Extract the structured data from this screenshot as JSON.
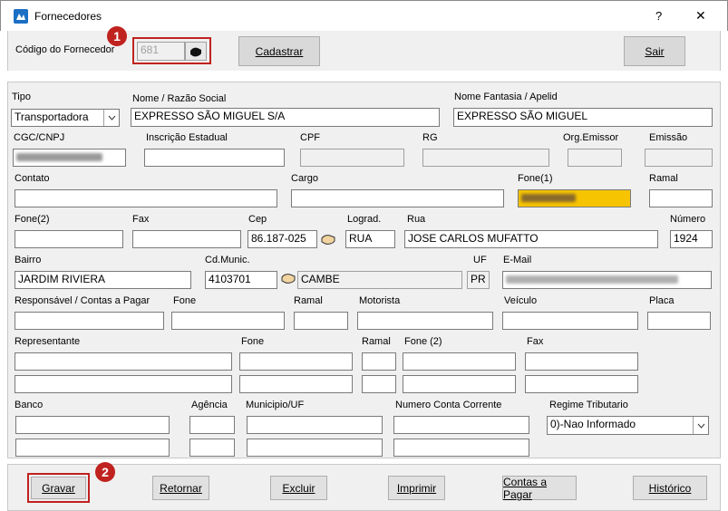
{
  "window": {
    "title": "Fornecedores",
    "help": "?",
    "close": "✕"
  },
  "top": {
    "codigo_label": "Código do Fornecedor",
    "codigo_value": "681",
    "cadastrar": "Cadastrar",
    "sair": "Sair",
    "badge1": "1"
  },
  "labels": {
    "tipo": "Tipo",
    "nome": "Nome / Razão Social",
    "fantasia": "Nome Fantasia / Apelid",
    "cgc": "CGC/CNPJ",
    "ie": "Inscrição Estadual",
    "cpf": "CPF",
    "rg": "RG",
    "orgemissor": "Org.Emissor",
    "emissao": "Emissão",
    "contato": "Contato",
    "cargo": "Cargo",
    "fone1": "Fone(1)",
    "ramal": "Ramal",
    "fone2": "Fone(2)",
    "fax": "Fax",
    "cep": "Cep",
    "lograd": "Lograd.",
    "rua": "Rua",
    "numero": "Número",
    "bairro": "Bairro",
    "cdmunic": "Cd.Munic.",
    "uf": "UF",
    "email": "E-Mail",
    "responsavel": "Responsável / Contas a Pagar",
    "fone_r": "Fone",
    "ramal_r": "Ramal",
    "motorista": "Motorista",
    "veiculo": "Veículo",
    "placa": "Placa",
    "representante": "Representante",
    "fone_rep": "Fone",
    "ramal_rep": "Ramal",
    "fone2_rep": "Fone (2)",
    "fax_rep": "Fax",
    "banco": "Banco",
    "agencia": "Agência",
    "municipio": "Municipio/UF",
    "conta": "Numero Conta Corrente",
    "regime": "Regime Tributario"
  },
  "values": {
    "tipo": "Transportadora",
    "nome": "EXPRESSO SÃO MIGUEL S/A",
    "fantasia": "EXPRESSO SÃO MIGUEL",
    "cep": "86.187-025",
    "lograd": "RUA",
    "rua": "JOSE CARLOS MUFATTO",
    "numero": "1924",
    "bairro": "JARDIM RIVIERA",
    "cdmunic": "4103701",
    "cidade": "CAMBE",
    "uf": "PR",
    "regime": "0)-Nao Informado"
  },
  "buttons": {
    "gravar": "Gravar",
    "retornar": "Retornar",
    "excluir": "Excluir",
    "imprimir": "Imprimir",
    "contas": "Contas a Pagar",
    "historico": "Histórico",
    "badge2": "2"
  },
  "colors": {
    "highlight": "#f6c400",
    "badge": "#c0221f",
    "panel": "#f0f0f0"
  }
}
